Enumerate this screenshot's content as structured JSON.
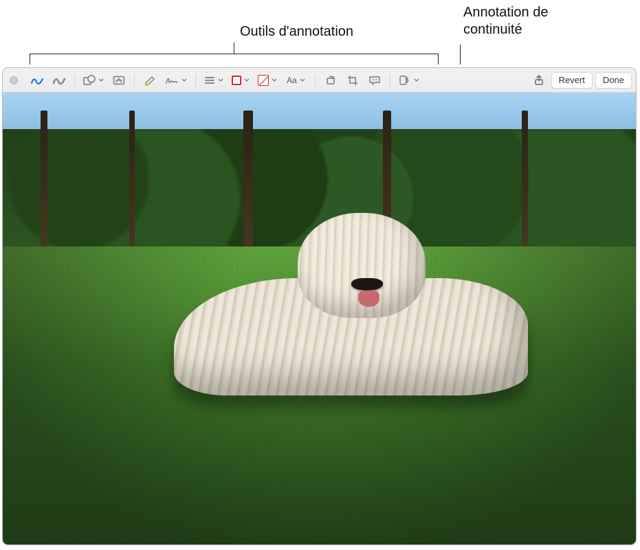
{
  "callouts": {
    "annotation_tools": "Outils d'annotation",
    "continuity_annotation": "Annotation de\ncontinuité"
  },
  "toolbar": {
    "font_label": "Aa",
    "revert_label": "Revert",
    "done_label": "Done",
    "icons": {
      "sketch": "sketch-icon",
      "draw": "draw-icon",
      "shapes": "shapes-icon",
      "text": "text-icon",
      "highlight": "highlight-icon",
      "sign": "sign-icon",
      "stroke": "shape-style-icon",
      "fill": "fill-color-icon",
      "linefill": "border-color-icon",
      "font": "text-style-icon",
      "rotate": "rotate-icon",
      "crop": "crop-icon",
      "describe": "image-description-icon",
      "continuity": "annotate-on-device-icon",
      "share": "share-icon"
    }
  }
}
